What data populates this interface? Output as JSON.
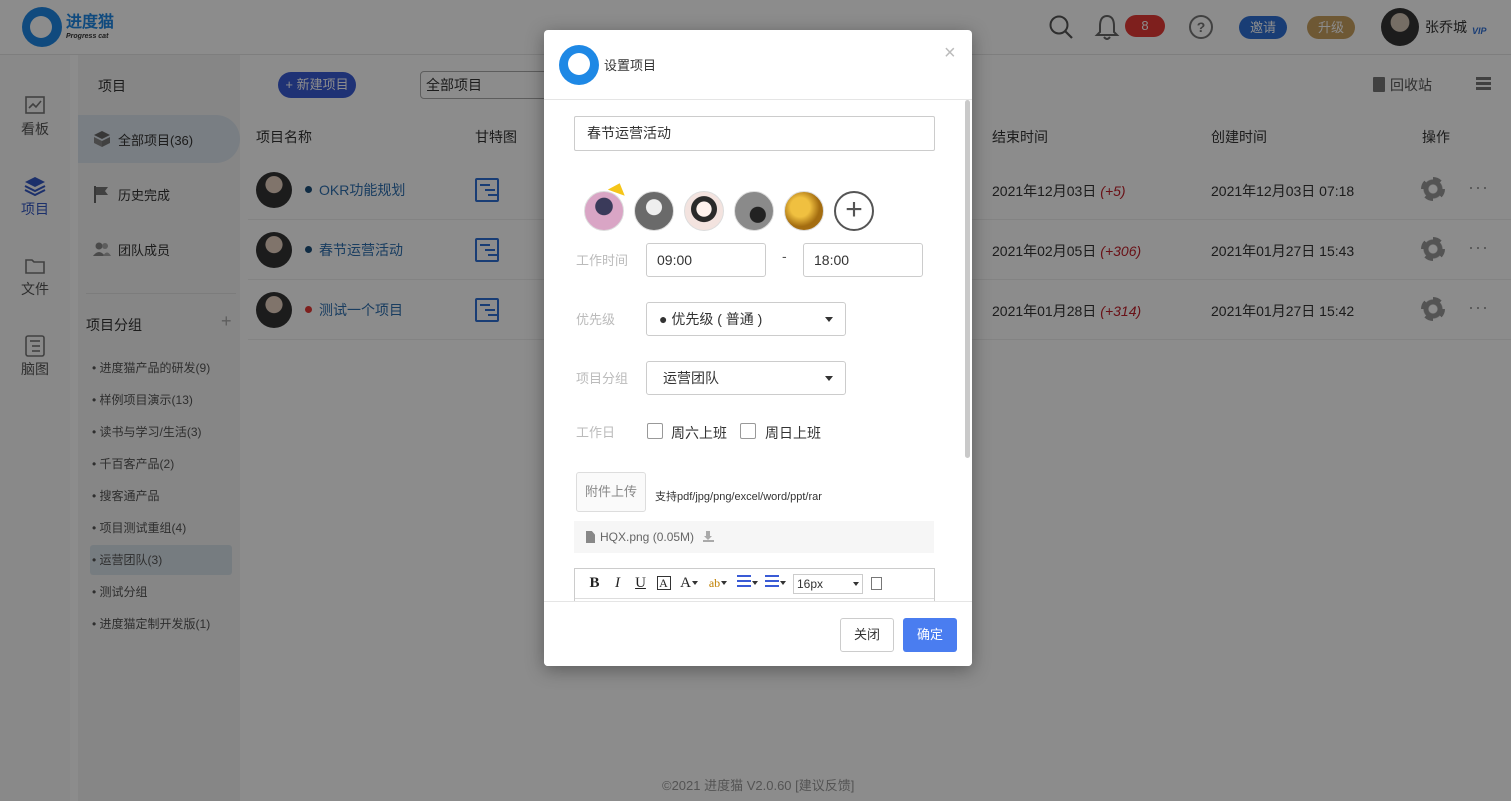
{
  "app": {
    "logo_cn": "进度猫",
    "logo_en": "Progress cat"
  },
  "topbar": {
    "notification_count": "8",
    "invite_label": "邀请",
    "upgrade_label": "升级",
    "user_name": "张乔城",
    "vip_label": "VIP"
  },
  "leftnav": [
    {
      "label": "看板",
      "icon": "chart-icon"
    },
    {
      "label": "项目",
      "icon": "layers-icon",
      "active": true
    },
    {
      "label": "文件",
      "icon": "folder-icon"
    },
    {
      "label": "脑图",
      "icon": "mindmap-icon"
    }
  ],
  "sidebar": {
    "title": "项目",
    "items": [
      {
        "label": "全部项目(36)",
        "icon": "cube-icon",
        "active": true
      },
      {
        "label": "历史完成",
        "icon": "flag-icon"
      },
      {
        "label": "团队成员",
        "icon": "users-icon"
      }
    ],
    "group_title": "项目分组",
    "group_add": "+",
    "groups": [
      "• 进度猫产品的研发(9)",
      "• 样例项目演示(13)",
      "• 读书与学习/生活(3)",
      "• 千百客产品(2)",
      "• 搜客通产品",
      "• 项目测试重组(4)",
      "• 运营团队(3)",
      "• 测试分组",
      "• 进度猫定制开发版(1)"
    ],
    "active_group_index": 6
  },
  "main": {
    "new_project_label": "+ 新建项目",
    "filter_value": "全部项目",
    "recycle_label": "回收站",
    "columns": {
      "name": "项目名称",
      "gantt": "甘特图",
      "end": "结束时间",
      "created": "创建时间",
      "actions": "操作"
    },
    "rows": [
      {
        "name": "OKR功能规划",
        "dot_color": "#1d4f7a",
        "end": "2021年12月03日",
        "delay": "(+5)",
        "created": "2021年12月03日 07:18"
      },
      {
        "name": "春节运营活动",
        "dot_color": "#1d4f7a",
        "end": "2021年02月05日",
        "delay": "(+306)",
        "created": "2021年01月27日 15:43"
      },
      {
        "name": "测试一个项目",
        "dot_color": "#e53935",
        "end": "2021年01月28日",
        "delay": "(+314)",
        "created": "2021年01月27日 15:42"
      }
    ]
  },
  "footer": {
    "text": "©2021 进度猫 V2.0.60  [建议反馈]"
  },
  "modal": {
    "title": "设置项目",
    "close": "×",
    "project_name": "春节运营活动",
    "members": [
      {
        "color": "#c98fb0",
        "owner": true
      },
      {
        "color": "#6a6a6a"
      },
      {
        "color": "#f1e0dc"
      },
      {
        "color": "#5a5a5a"
      },
      {
        "color": "#c8951f"
      }
    ],
    "add_member": "+",
    "work_time_label": "工作时间",
    "start_time": "09:00",
    "time_sep": "-",
    "end_time": "18:00",
    "priority_label": "优先级",
    "priority_value": "● 优先级 ( 普通 )",
    "group_label": "项目分组",
    "group_value": "运营团队",
    "workday_label": "工作日",
    "saturday_label": "周六上班",
    "sunday_label": "周日上班",
    "upload_label": "附件上传",
    "upload_hint": "支持pdf/jpg/png/excel/word/ppt/rar",
    "attachment": "HQX.png (0.05M)",
    "editor_font_size": "16px",
    "cancel_label": "关闭",
    "ok_label": "确定"
  }
}
